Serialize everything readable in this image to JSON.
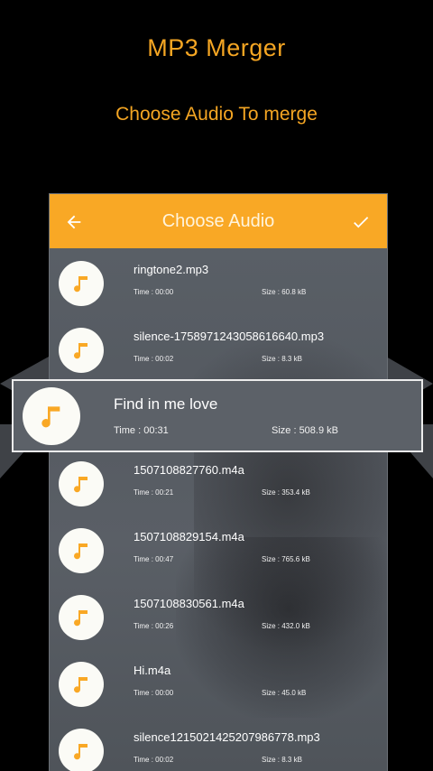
{
  "promo": {
    "title": "MP3 Merger",
    "subtitle": "Choose Audio To merge"
  },
  "appbar": {
    "title": "Choose Audio",
    "back_icon": "arrow-back-icon",
    "confirm_icon": "checkmark-icon"
  },
  "colors": {
    "accent": "#f9a825",
    "promo_text": "#f5a623",
    "background": "#000000"
  },
  "items": [
    {
      "name": "ringtone2.mp3",
      "time": "Time : 00:00",
      "size": "Size : 60.8 kB"
    },
    {
      "name": "silence-1758971243058616640.mp3",
      "time": "Time : 00:02",
      "size": "Size : 8.3 kB"
    },
    {
      "name": "1507108827760.m4a",
      "time": "Time : 00:21",
      "size": "Size : 353.4 kB"
    },
    {
      "name": "1507108829154.m4a",
      "time": "Time : 00:47",
      "size": "Size : 765.6 kB"
    },
    {
      "name": "1507108830561.m4a",
      "time": "Time : 00:26",
      "size": "Size : 432.0 kB"
    },
    {
      "name": "Hi.m4a",
      "time": "Time : 00:00",
      "size": "Size : 45.0 kB"
    },
    {
      "name": "silence1215021425207986778.mp3",
      "time": "Time : 00:02",
      "size": "Size : 8.3 kB"
    }
  ],
  "highlighted": {
    "name": "Find in me love",
    "time": "Time : 00:31",
    "size": "Size : 508.9 kB"
  }
}
